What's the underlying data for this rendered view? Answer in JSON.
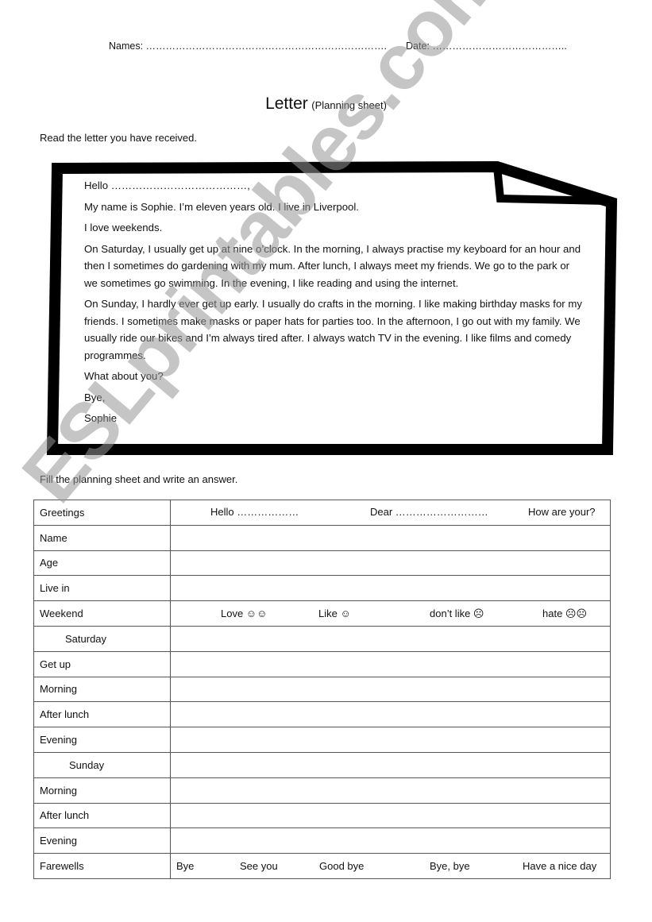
{
  "header": {
    "names_label": "Names: ……………………………………………………………….",
    "date_label": "Date: ………………………………….."
  },
  "title": {
    "main": "Letter",
    "sub": "(Planning sheet)"
  },
  "instructions": {
    "read": "Read the letter you have received.",
    "fill": "Fill the planning sheet and write an answer."
  },
  "letter": {
    "greeting": "Hello …………………………………,",
    "paragraphs": [
      "My name is Sophie. I’m eleven years old. I live in Liverpool.",
      "I love weekends.",
      "On Saturday, I usually get up at nine o’clock. In the morning, I always practise my keyboard for an hour and then I sometimes do gardening with my mum. After lunch, I always meet my friends. We go to the park or we sometimes go swimming. In the evening, I like reading and using the internet.",
      "On Sunday, I hardly ever get up early. I usually do crafts in the morning. I like making birthday masks for my friends. I sometimes make masks or paper hats for parties too. In the afternoon, I go out with my family. We usually ride our bikes and I’m always tired after. I always watch TV in the evening. I like films and comedy programmes.",
      "What about you?",
      "Bye,",
      "Sophie"
    ]
  },
  "planning_table": {
    "rows": [
      {
        "label": "Greetings",
        "options": [
          "Hello ………………",
          "Dear ………………………",
          "How are your?"
        ]
      },
      {
        "label": "Name"
      },
      {
        "label": "Age"
      },
      {
        "label": "Live in"
      },
      {
        "label": "Weekend",
        "options": [
          "Love ☺☺",
          "Like ☺",
          "don’t like ☹",
          "hate ☹☹"
        ]
      },
      {
        "label": "Saturday",
        "subheader": true
      },
      {
        "label": "Get up"
      },
      {
        "label": "Morning"
      },
      {
        "label": "After lunch"
      },
      {
        "label": "Evening"
      },
      {
        "label": "Sunday",
        "subheader": true
      },
      {
        "label": "Morning"
      },
      {
        "label": "After lunch"
      },
      {
        "label": "Evening"
      },
      {
        "label": "Farewells",
        "options": [
          "Bye",
          "See you",
          "Good bye",
          "Bye, bye",
          "Have a nice day"
        ]
      }
    ]
  },
  "watermark": "ESLprintables.com"
}
